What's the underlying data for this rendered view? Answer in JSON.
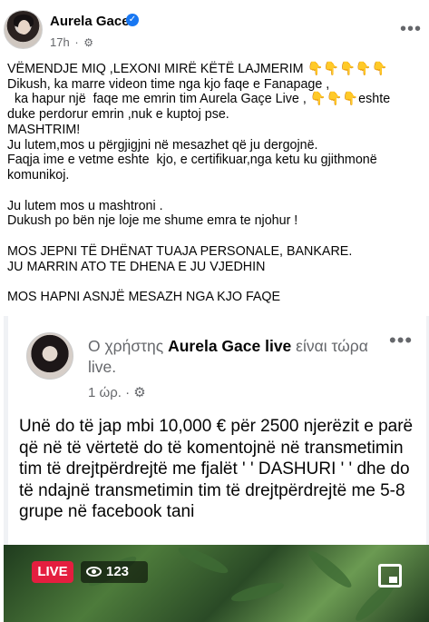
{
  "post": {
    "author": "Aurela Gace",
    "time": "17h",
    "lines_block1": [
      "VËMENDJE MIQ ,LEXONI MIRË KËTË LAJMERIM ",
      "Dikush, ka marre videon time nga kjo faqe e Fanapage ,",
      "  ka hapur një  faqe me emrin tim Aurela Gaçe Live , ",
      "duke perdorur emrin ,nuk e kuptoj pse.",
      "MASHTRIM!",
      "Ju lutem,mos u përgjigjni në mesazhet që ju dergojnë.",
      "Faqja ime e vetme eshte  kjo, e certifikuar,nga ketu ku gjithmonë",
      "komunikoj."
    ],
    "emoji_line1": "👇👇👇👇👇",
    "emoji_line3": "👇👇👇",
    "emoji_after3": "eshte",
    "lines_block2": [
      "Ju lutem mos u mashtroni .",
      "Dukush po bën nje loje me shume emra te njohur !"
    ],
    "lines_block3": [
      "MOS JEPNI TË DHËNAT TUAJA PERSONALE, BANKARE.",
      "JU MARRIN ATO TE DHENA E JU VJEDHIN"
    ],
    "line_final": "MOS HAPNI ASNJË MESAZH NGA KJO FAQE"
  },
  "shared": {
    "title_prefix": "Ο χρήστης ",
    "title_name": "Aurela Gace live",
    "title_suffix": " είναι τώρα live.",
    "time": "1 ώρ.",
    "body": "Unë do të jap mbi 10,000 € për 2500 njerëzit e parë që në të vërtetë do të komentojnë në transmetimin tim të drejtpërdrejtë me fjalët ' ' DASHURI ' ' dhe do të ndajnë transmetimin tim të drejtpërdrejtë me 5-8 grupe në facebook tani",
    "live_label": "LIVE",
    "viewers": "123"
  },
  "icons": {
    "verified": "verified-badge-icon",
    "privacy": "gear-icon",
    "more": "more-options-icon",
    "eye": "eye-icon",
    "pip": "picture-in-picture-icon"
  },
  "colors": {
    "accent": "#1877f2",
    "live": "#e41e3f",
    "secondary_text": "#65676b"
  }
}
